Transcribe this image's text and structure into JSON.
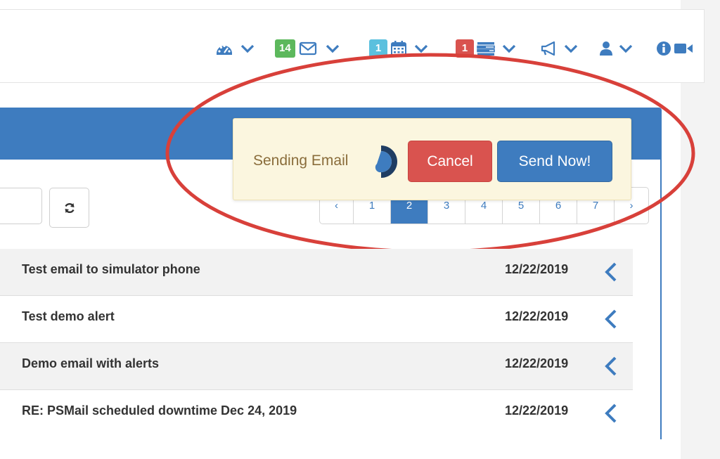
{
  "header": {
    "badges": {
      "mail": "14",
      "calendar": "1",
      "tasks": "1"
    },
    "icons": [
      "dashboard-icon",
      "envelope-icon",
      "calendar-icon",
      "task-list-icon",
      "megaphone-icon",
      "user-icon",
      "info-icon",
      "video-camera-icon"
    ]
  },
  "toolbar": {
    "refresh_icon": "refresh-icon"
  },
  "pagination": {
    "prev": "‹",
    "next": "›",
    "pages": [
      "1",
      "2",
      "3",
      "4",
      "5",
      "6",
      "7"
    ],
    "active_page": "2"
  },
  "popup": {
    "message": "Sending Email",
    "cancel_label": "Cancel",
    "send_label": "Send Now!"
  },
  "emails": [
    {
      "subject": "Test email to simulator phone",
      "date": "12/22/2019"
    },
    {
      "subject": "Test demo alert",
      "date": "12/22/2019"
    },
    {
      "subject": "Demo email with alerts",
      "date": "12/22/2019"
    },
    {
      "subject": "RE: PSMail scheduled downtime Dec 24, 2019",
      "date": "12/22/2019"
    }
  ],
  "colors": {
    "primary": "#3e7cbf",
    "danger": "#d9534f",
    "success": "#5cb85c",
    "info": "#5bc0de",
    "warning_bg": "#fbf6df",
    "warning_text": "#8a6d3b",
    "annotation": "#d8403a"
  }
}
